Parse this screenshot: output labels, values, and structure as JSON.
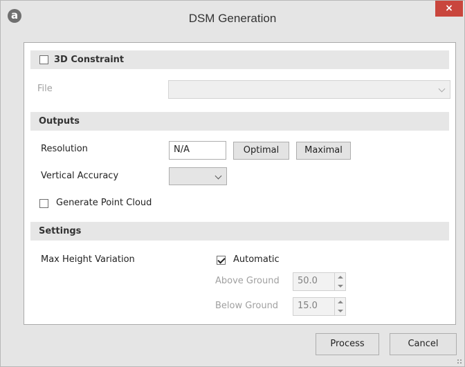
{
  "window": {
    "title": "DSM Generation",
    "logo_letter": "a",
    "close_glyph": "×"
  },
  "constraint": {
    "label": "3D Constraint",
    "checked": false,
    "file_label": "File",
    "file_value": ""
  },
  "outputs": {
    "section_title": "Outputs",
    "resolution_label": "Resolution",
    "resolution_value": "N/A",
    "optimal_button": "Optimal",
    "maximal_button": "Maximal",
    "vertical_accuracy_label": "Vertical Accuracy",
    "vertical_accuracy_value": "",
    "point_cloud_label": "Generate Point Cloud",
    "point_cloud_checked": false
  },
  "settings": {
    "section_title": "Settings",
    "max_height_label": "Max Height Variation",
    "automatic_label": "Automatic",
    "automatic_checked": true,
    "above_ground_label": "Above Ground",
    "above_ground_value": "50.0",
    "below_ground_label": "Below Ground",
    "below_ground_value": "15.0"
  },
  "footer": {
    "process_button": "Process",
    "cancel_button": "Cancel"
  },
  "colors": {
    "close_button": "#c9463d",
    "section_bar": "#e6e6e6",
    "window_bg": "#e5e5e5"
  }
}
